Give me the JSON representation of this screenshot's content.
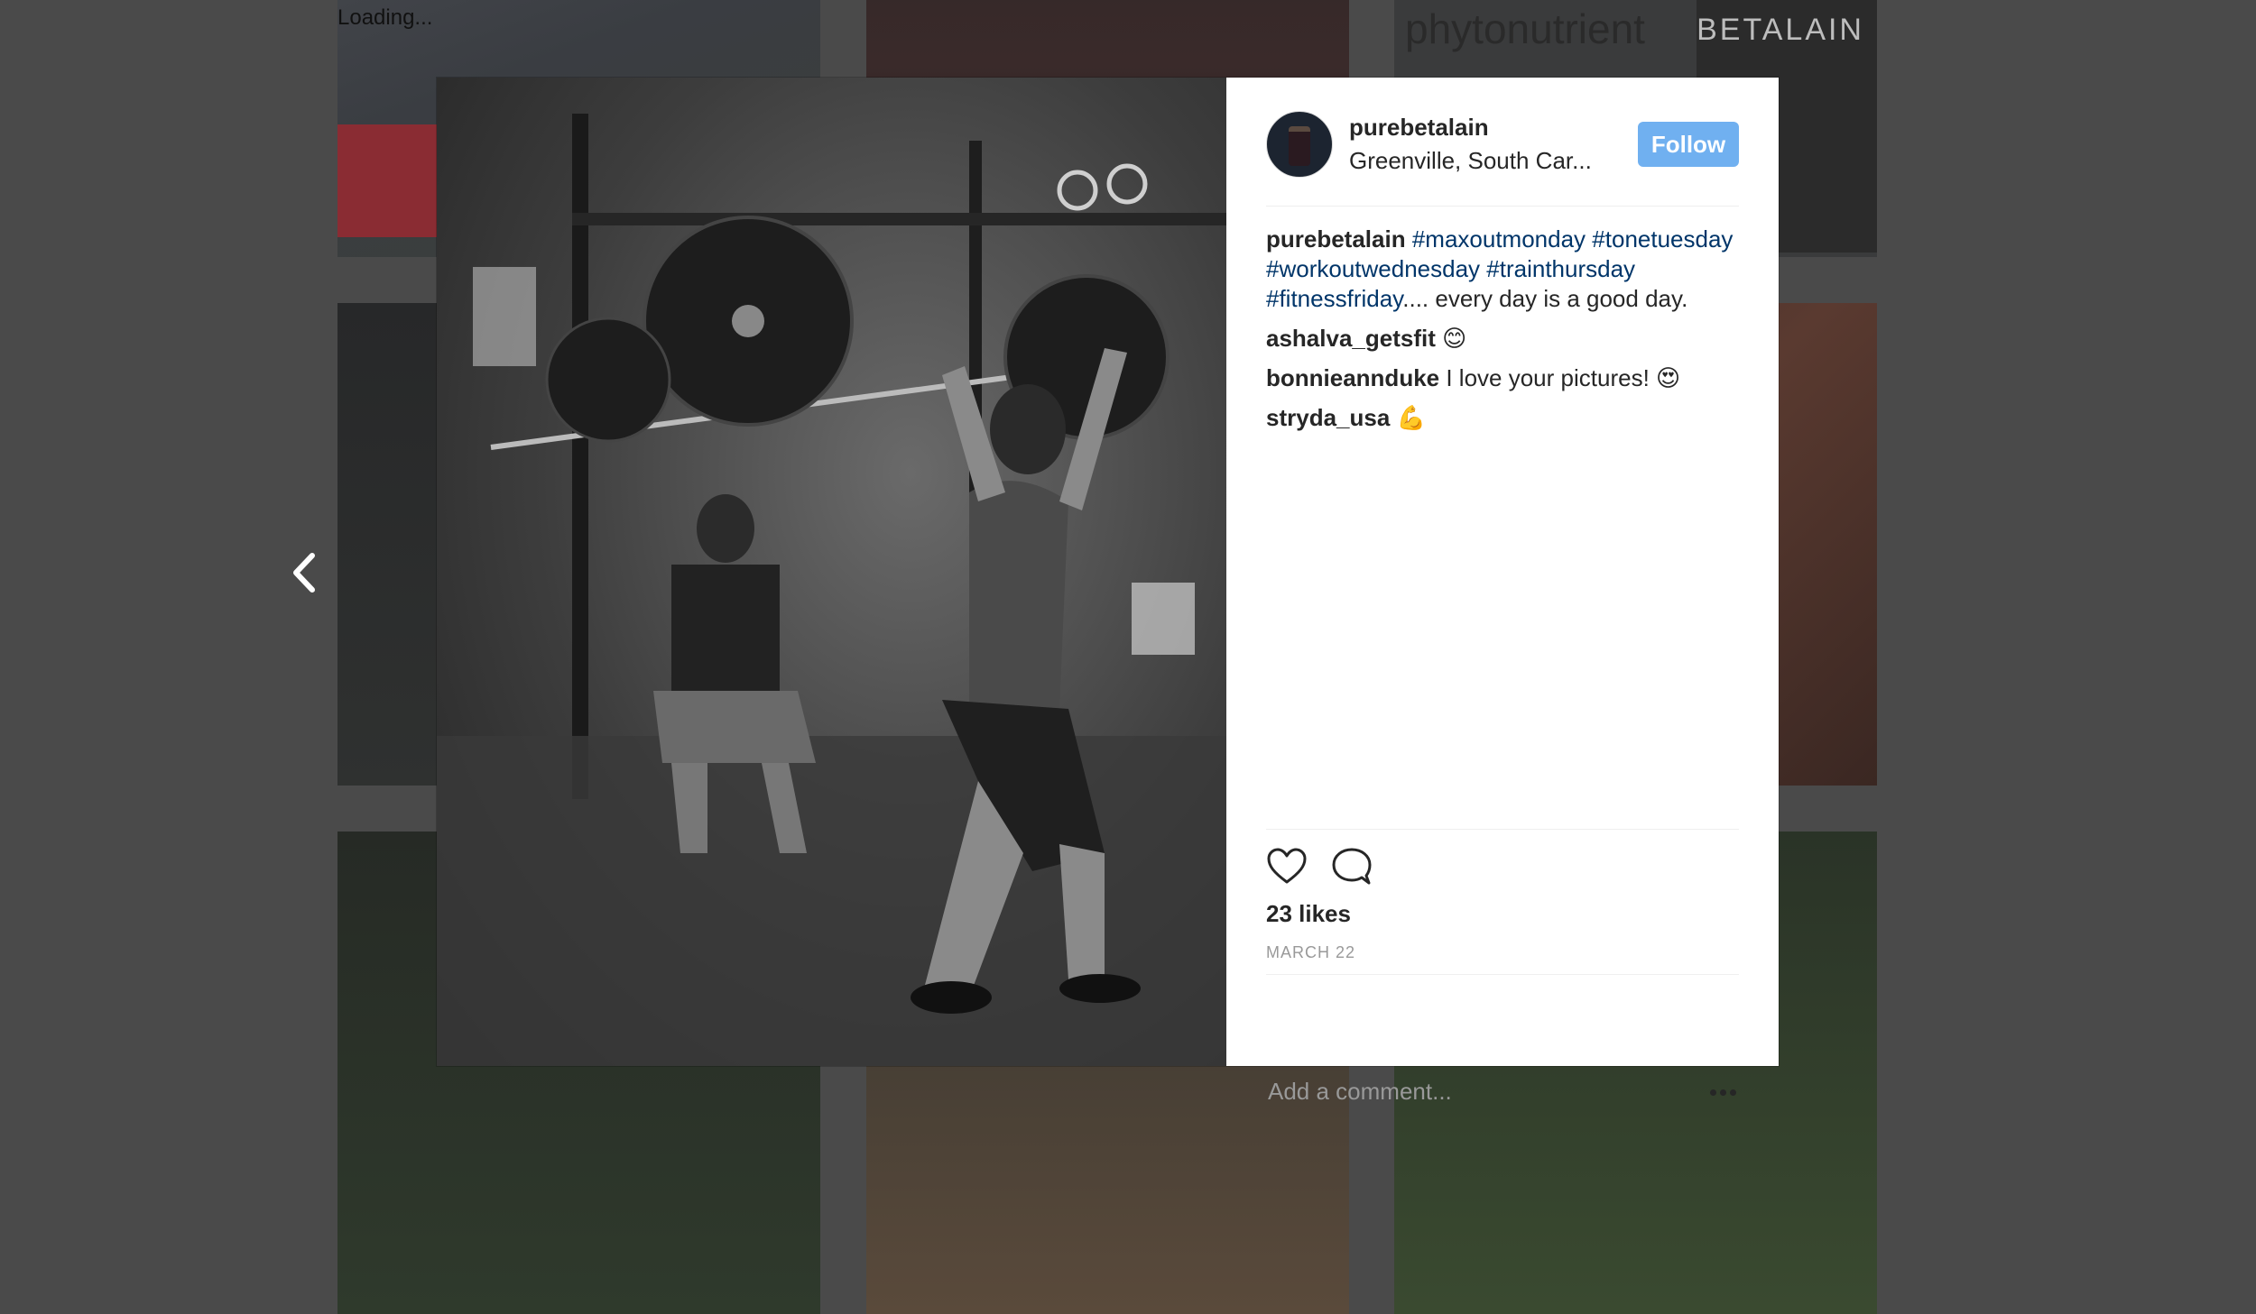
{
  "loading_text": "Loading...",
  "background": {
    "tiles": [
      {
        "id": "tile-1"
      },
      {
        "id": "tile-2"
      },
      {
        "id": "tile-3",
        "text": "phytonutrient",
        "side_text": "BETALAIN"
      },
      {
        "id": "tile-4"
      },
      {
        "id": "tile-5"
      },
      {
        "id": "tile-6"
      },
      {
        "id": "tile-7"
      },
      {
        "id": "tile-8"
      },
      {
        "id": "tile-9"
      }
    ]
  },
  "nav": {
    "prev_icon": "chevron-left-icon"
  },
  "post": {
    "username": "purebetalain",
    "location": "Greenville, South Car...",
    "follow_label": "Follow",
    "caption": {
      "user": "purebetalain",
      "tags": [
        "#maxoutmonday",
        "#tonetuesday",
        "#workoutwednesday",
        "#trainthursday",
        "#fitnessfriday"
      ],
      "text": ".... every day is a good day."
    },
    "comments": [
      {
        "user": "ashalva_getsfit",
        "text": "😊"
      },
      {
        "user": "bonnieannduke",
        "text": "I love your pictures! 😍"
      },
      {
        "user": "stryda_usa",
        "text": "💪"
      }
    ],
    "likes": "23 likes",
    "date": "MARCH 22",
    "comment_placeholder": "Add a comment...",
    "icons": {
      "like": "heart-icon",
      "comment": "comment-icon",
      "more": "more-options-icon"
    }
  },
  "colors": {
    "follow": "#70b0f0",
    "hashtag": "#003569",
    "overlay": "#4a4a4a"
  }
}
